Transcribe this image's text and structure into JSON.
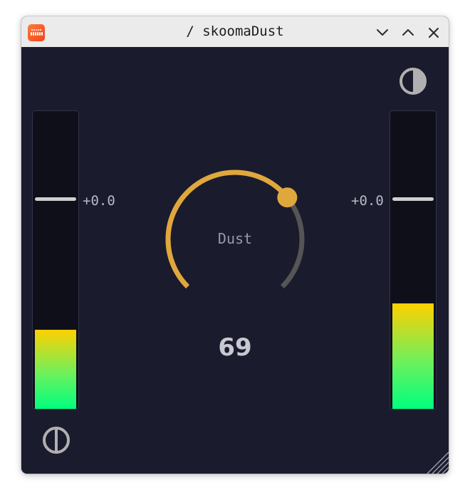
{
  "window": {
    "title": "/ skoomaDust",
    "app_icon": "bitwig-app-icon"
  },
  "titlebar_buttons": [
    "minimize",
    "maximize",
    "close"
  ],
  "left_meter": {
    "gain_label": "+0.0",
    "level": 0.265,
    "handle_level": 0.705
  },
  "right_meter": {
    "gain_label": "+0.0",
    "level": 0.355,
    "handle_level": 0.705
  },
  "knob": {
    "label": "Dust",
    "value": "69",
    "fraction": 0.69
  },
  "icons": {
    "top_right": "contrast-half-icon",
    "bottom_left": "phase-circle-icon"
  },
  "colors": {
    "background": "#1b1b2e",
    "knob_active": "#e0a83c",
    "knob_track": "#555555",
    "meter_bottom": "#00ff80",
    "meter_top": "#ffd000"
  }
}
